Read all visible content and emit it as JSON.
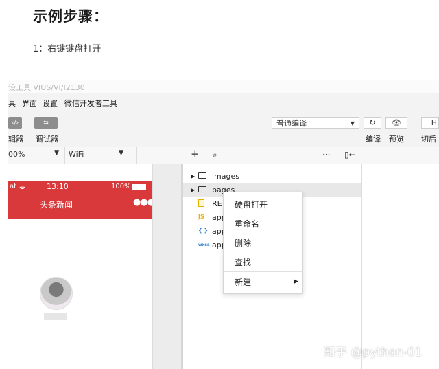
{
  "article": {
    "heading": "示例步骤：",
    "step1": "1：右键键盘打开"
  },
  "ide": {
    "title_fragment": "设工具 VIUS/VI/I2130",
    "menu": [
      "具",
      "界面",
      "设置",
      "微信开发者工具"
    ],
    "toolbar": {
      "editor_label": "辑器",
      "debugger_label": "调试器",
      "compile_mode": "普通编译",
      "compile_label": "编译",
      "preview_label": "预览",
      "switch_label": "切后",
      "refresh_icon": "refresh-icon",
      "eye_icon": "eye-icon"
    },
    "subbar": {
      "zoom": "00%",
      "network": "WiFi"
    },
    "phone": {
      "carrier": "at",
      "time": "13:10",
      "battery": "100%",
      "nav_title": "头条新闻"
    },
    "tree": {
      "items": [
        {
          "label": "images",
          "type": "folder"
        },
        {
          "label": "pages",
          "type": "folder"
        },
        {
          "label": "RE",
          "type": "file"
        },
        {
          "label": "app",
          "type": "js",
          "icon_text": "JS"
        },
        {
          "label": "app",
          "type": "json",
          "icon_text": "{ }"
        },
        {
          "label": "app",
          "type": "wxss",
          "icon_text": "wxss"
        }
      ]
    },
    "context_menu": {
      "items": [
        "硬盘打开",
        "重命名",
        "删除",
        "查找"
      ],
      "new_label": "新建"
    }
  },
  "watermark": "知乎 @python-01",
  "colors": {
    "phone_header": "#d9393a",
    "selection": "#e8e8e8"
  }
}
